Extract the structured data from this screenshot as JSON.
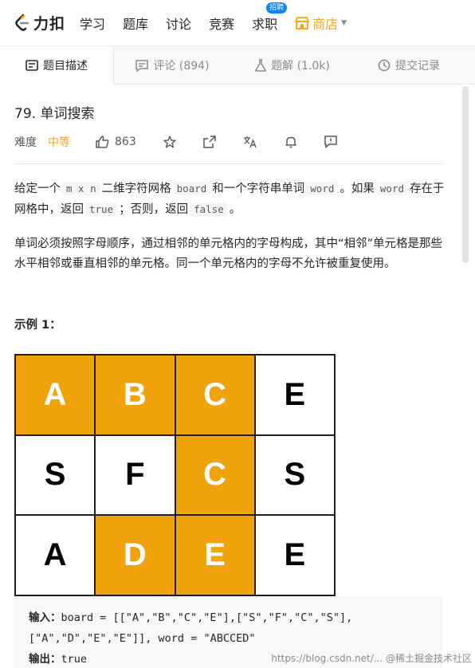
{
  "nav": {
    "brand": "力扣",
    "items": [
      "学习",
      "题库",
      "讨论",
      "竞赛",
      "求职"
    ],
    "badge": "招聘",
    "store": "商店",
    "brand_color": "#ffa116"
  },
  "tabs": [
    {
      "label": "题目描述",
      "icon": "document-icon"
    },
    {
      "label": "评论 (894)",
      "icon": "comment-icon"
    },
    {
      "label": "题解 (1.0k)",
      "icon": "flask-icon"
    },
    {
      "label": "提交记录",
      "icon": "clock-icon"
    }
  ],
  "problem": {
    "title": "79. 单词搜索",
    "difficulty_label": "难度",
    "difficulty": "中等",
    "likes": "863"
  },
  "description": {
    "p1_a": "给定一个",
    "p1_code1": "m x n",
    "p1_b": "二维字符网格",
    "p1_code2": "board",
    "p1_c": "和一个字符串单词",
    "p1_code3": "word",
    "p1_d": "。如果",
    "p1_code4": "word",
    "p1_e": "存在于网格中，返回",
    "p1_code5": "true",
    "p1_f": "；否则，返回",
    "p1_code6": "false",
    "p1_g": "。",
    "p2": "单词必须按照字母顺序，通过相邻的单元格内的字母构成，其中“相邻”单元格是那些水平相邻或垂直相邻的单元格。同一个单元格内的字母不允许被重复使用。"
  },
  "example": {
    "title": "示例 1：",
    "grid": [
      [
        {
          "ch": "A",
          "on": true
        },
        {
          "ch": "B",
          "on": true
        },
        {
          "ch": "C",
          "on": true
        },
        {
          "ch": "E",
          "on": false
        }
      ],
      [
        {
          "ch": "S",
          "on": false
        },
        {
          "ch": "F",
          "on": false
        },
        {
          "ch": "C",
          "on": true
        },
        {
          "ch": "S",
          "on": false
        }
      ],
      [
        {
          "ch": "A",
          "on": false
        },
        {
          "ch": "D",
          "on": true
        },
        {
          "ch": "E",
          "on": true
        },
        {
          "ch": "E",
          "on": false
        }
      ]
    ],
    "highlight_color": "#f0a30a",
    "input_label": "输入：",
    "input_line1": "board = [[\"A\",\"B\",\"C\",\"E\"],[\"S\",\"F\",\"C\",\"S\"],",
    "input_line2": "[\"A\",\"D\",\"E\",\"E\"]], word = \"ABCCED\"",
    "output_label": "输出：",
    "output": "true"
  },
  "watermark": "https://blog.csdn.net/... @稀土掘金技术社区"
}
